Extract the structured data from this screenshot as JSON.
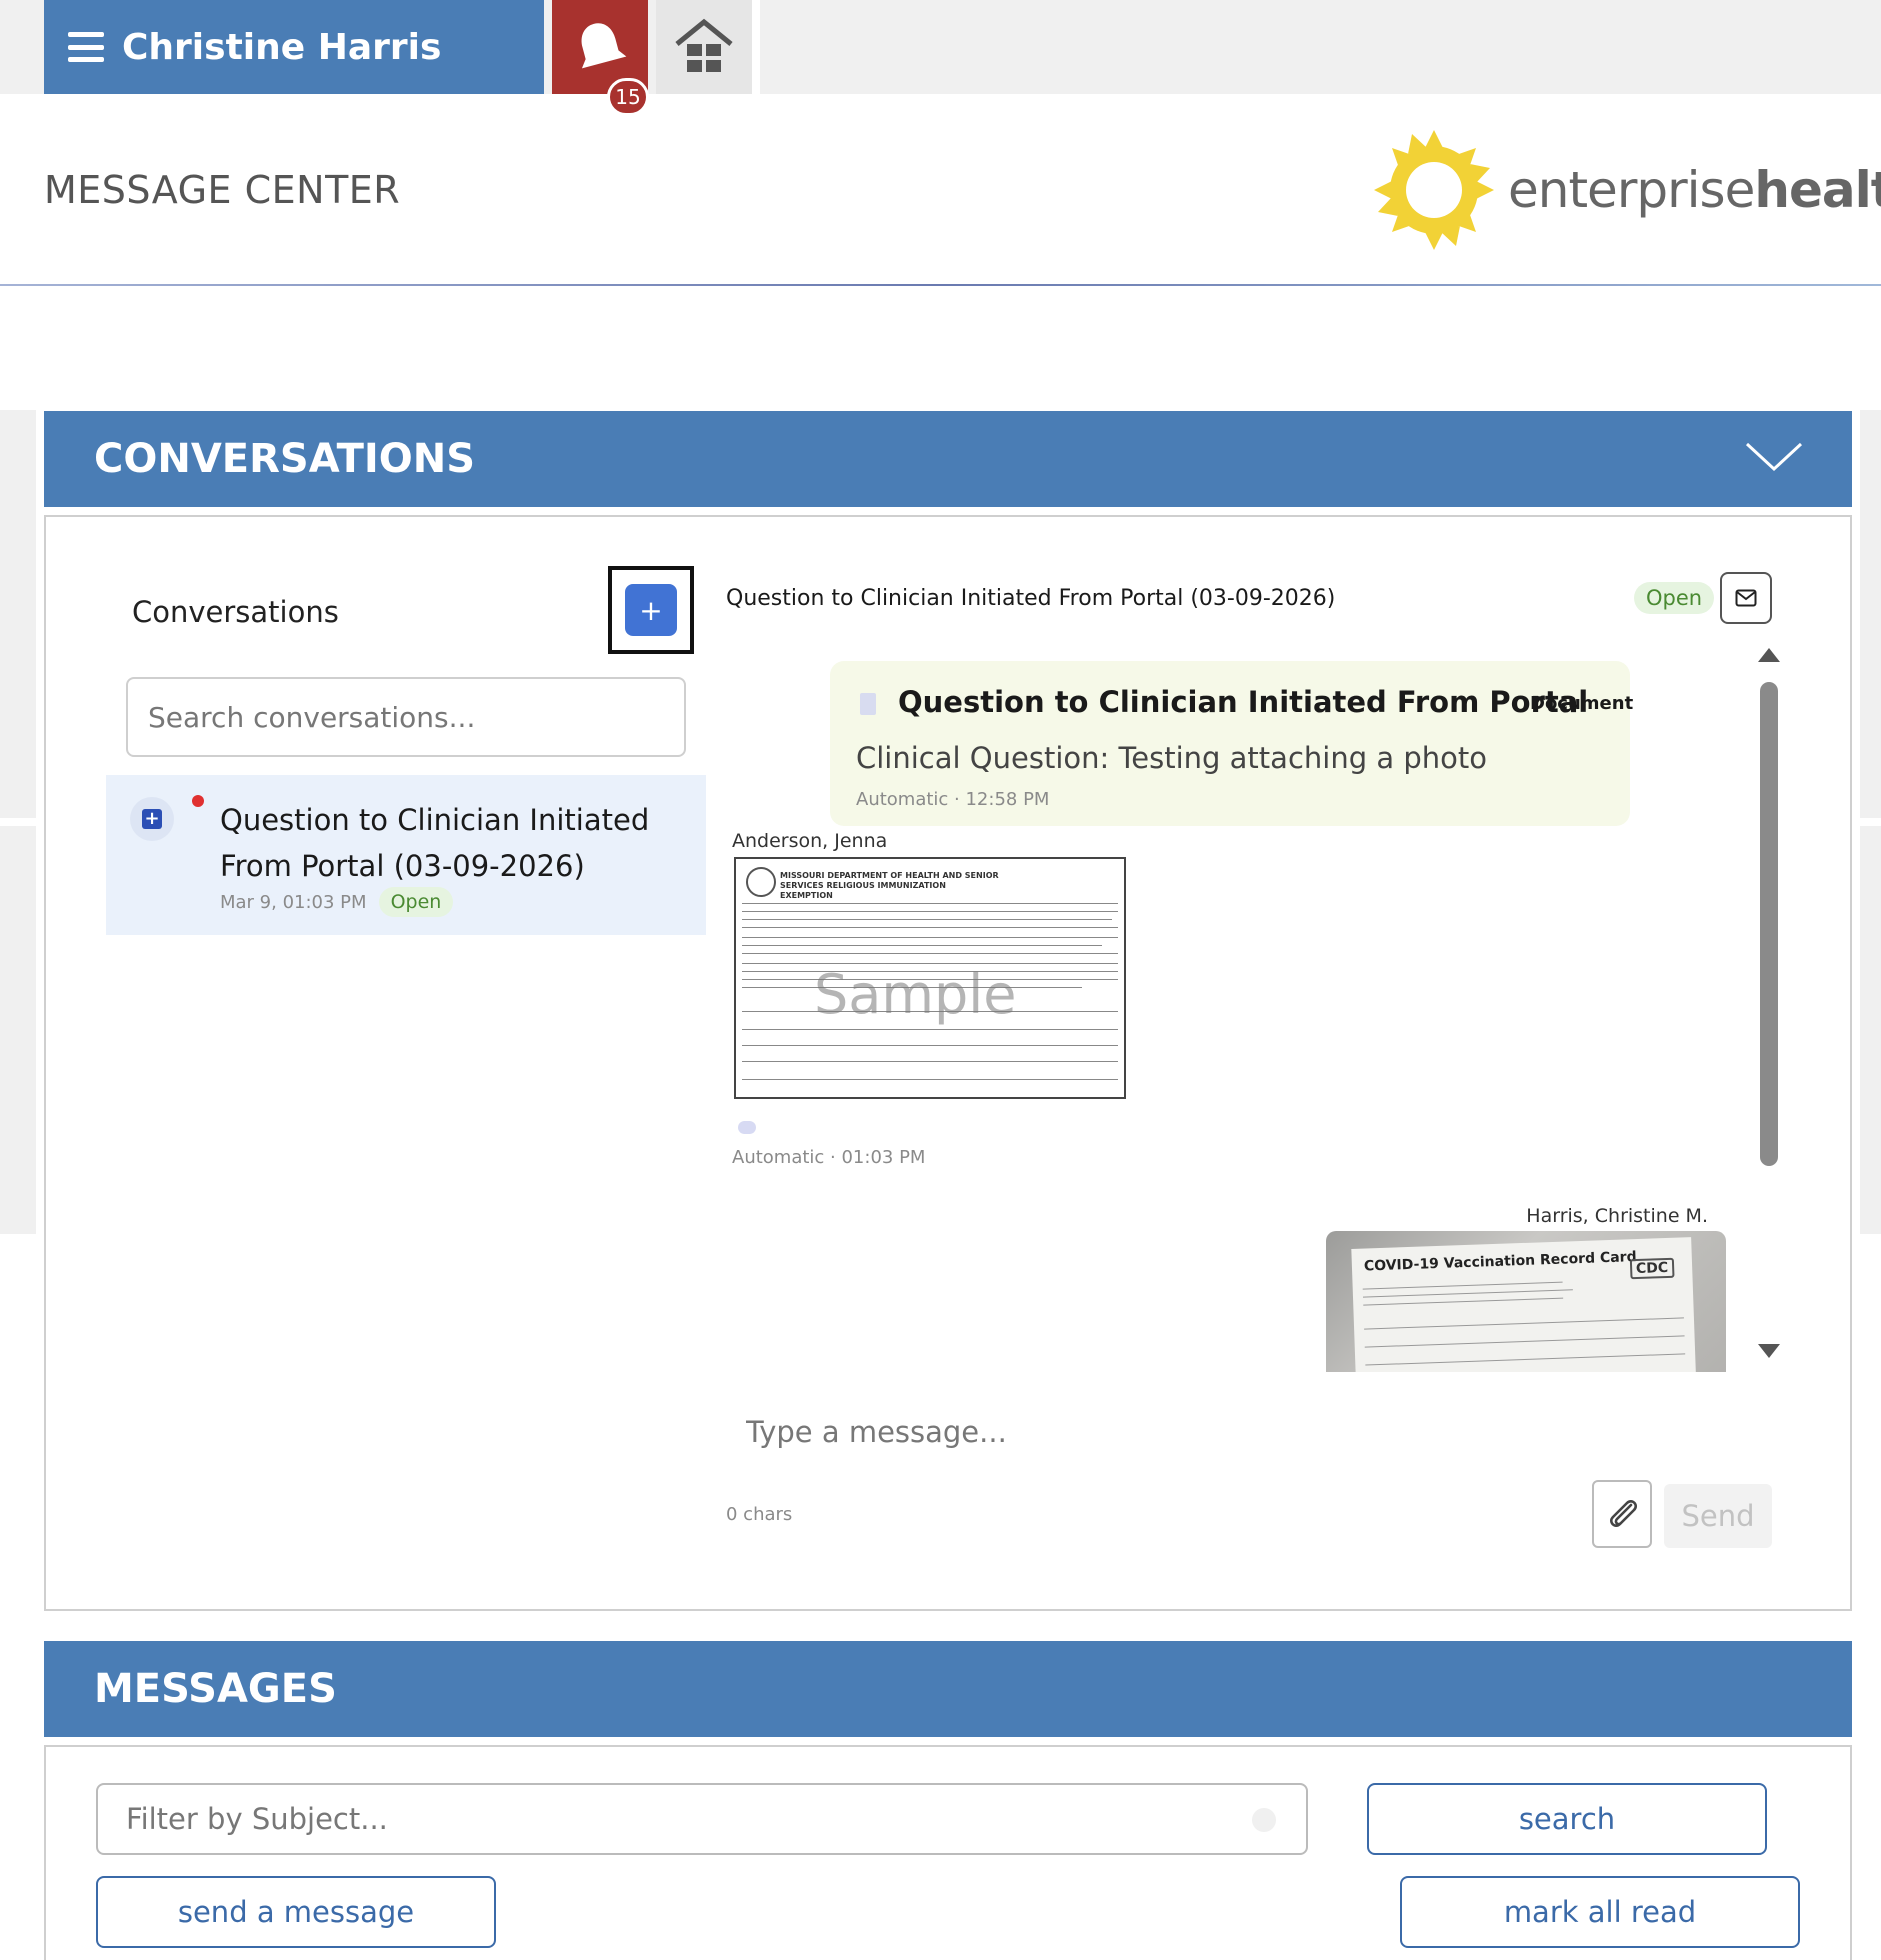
{
  "header": {
    "user_name": "Christine Harris",
    "notification_count": "15",
    "page_title": "MESSAGE CENTER",
    "logo_text_light": "enterprise",
    "logo_text_bold": "health"
  },
  "conversations_section": {
    "title": "CONVERSATIONS",
    "list_heading": "Conversations",
    "add_label": "+",
    "search_placeholder": "Search conversations...",
    "items": [
      {
        "title": "Question to Clinician Initiated From Portal (03-09-2026)",
        "date": "Mar 9, 01:03 PM",
        "status": "Open",
        "unread": true
      }
    ]
  },
  "detail": {
    "title": "Question to Clinician Initiated From Portal (03-09-2026)",
    "status": "Open",
    "messages": [
      {
        "type": "document",
        "title": "Question to Clinician Initiated From Portal",
        "doc_label": "Document",
        "body": "Clinical Question: Testing attaching a photo",
        "meta": "Automatic · 12:58 PM"
      },
      {
        "sender": "Anderson, Jenna",
        "attachment_header": "MISSOURI DEPARTMENT OF HEALTH AND SENIOR SERVICES RELIGIOUS IMMUNIZATION EXEMPTION",
        "watermark": "Sample",
        "meta": "Automatic · 01:03 PM"
      },
      {
        "sender": "Harris, Christine M.",
        "attachment_title": "COVID-19 Vaccination Record Card",
        "attachment_logo": "CDC"
      }
    ],
    "composer": {
      "placeholder": "Type a message...",
      "char_count": "0 chars",
      "send_label": "Send"
    }
  },
  "messages_section": {
    "title": "MESSAGES",
    "filter_placeholder": "Filter by Subject...",
    "search_label": "search",
    "send_message_label": "send a message",
    "mark_all_read_label": "mark all read"
  },
  "colors": {
    "brand_blue": "#4a7db5",
    "notification_red": "#a8322e",
    "open_green": "#4a8a32",
    "logo_yellow": "#f2d236"
  }
}
